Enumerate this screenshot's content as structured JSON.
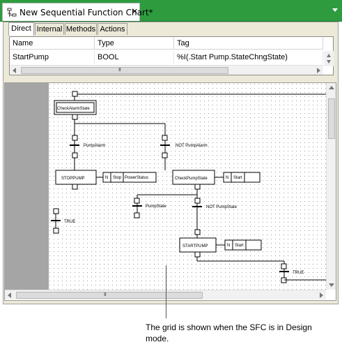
{
  "document_tab": {
    "title": "New Sequential Function Chart*",
    "close_glyph": "✕",
    "icon": "sfc-document-icon"
  },
  "var_tabs": [
    "Direct",
    "Internal",
    "Methods",
    "Actions"
  ],
  "active_var_tab": "Direct",
  "var_grid": {
    "columns": [
      "Name",
      "Type",
      "Tag"
    ],
    "rows": [
      [
        "StartPump",
        "BOOL",
        "%I(.Start Pump.StateChngState)"
      ]
    ]
  },
  "scroll_grip": "III",
  "sfc": {
    "steps": [
      {
        "id": "init",
        "label": "CheckAlarmState",
        "initial": true
      },
      {
        "id": "stop",
        "label": "STOPPUMP"
      },
      {
        "id": "check",
        "label": "CheckPumpState"
      },
      {
        "id": "start",
        "label": "STARTPUMP"
      }
    ],
    "transitions": [
      "PumpAlarm",
      "NOT PumpAlarm",
      "TRUE",
      "PumpState",
      "NOT PumpState",
      "TRUE"
    ],
    "actions": {
      "stop": {
        "qualifier": "N",
        "cells": [
          "Stop",
          "PowerStatus"
        ]
      },
      "check": {
        "qualifier": "N",
        "cells": [
          "Start",
          ""
        ]
      },
      "start": {
        "qualifier": "N",
        "cells": [
          "Start",
          ""
        ]
      }
    }
  },
  "caption": "The grid is shown when the SFC is in Design mode.",
  "colors": {
    "title_bar": "#2e9b3f",
    "panel": "#ece9d8",
    "gutter": "#a5a5a5",
    "grid_dot": "#9a9a9a"
  }
}
